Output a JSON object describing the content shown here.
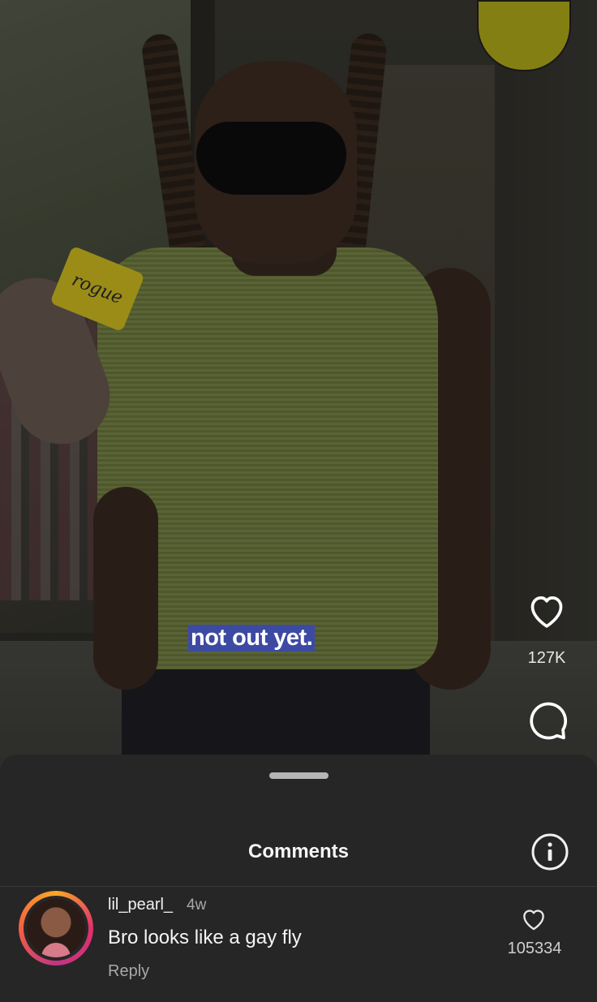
{
  "video": {
    "caption": "not out yet.",
    "mic_label": "rogue",
    "likes_count": "127K"
  },
  "comments_sheet": {
    "title": "Comments",
    "comments": [
      {
        "username": "lil_pearl_",
        "age": "4w",
        "text": "Bro looks like a gay fly",
        "reply_label": "Reply",
        "like_count": "105334"
      }
    ]
  },
  "icons": {
    "like": "heart-outline-icon",
    "comment": "comment-bubble-icon",
    "info": "info-icon"
  },
  "colors": {
    "sheet_bg": "#262626",
    "caption_bg": "#3d4aa3",
    "secondary_text": "#a8a8a8"
  }
}
